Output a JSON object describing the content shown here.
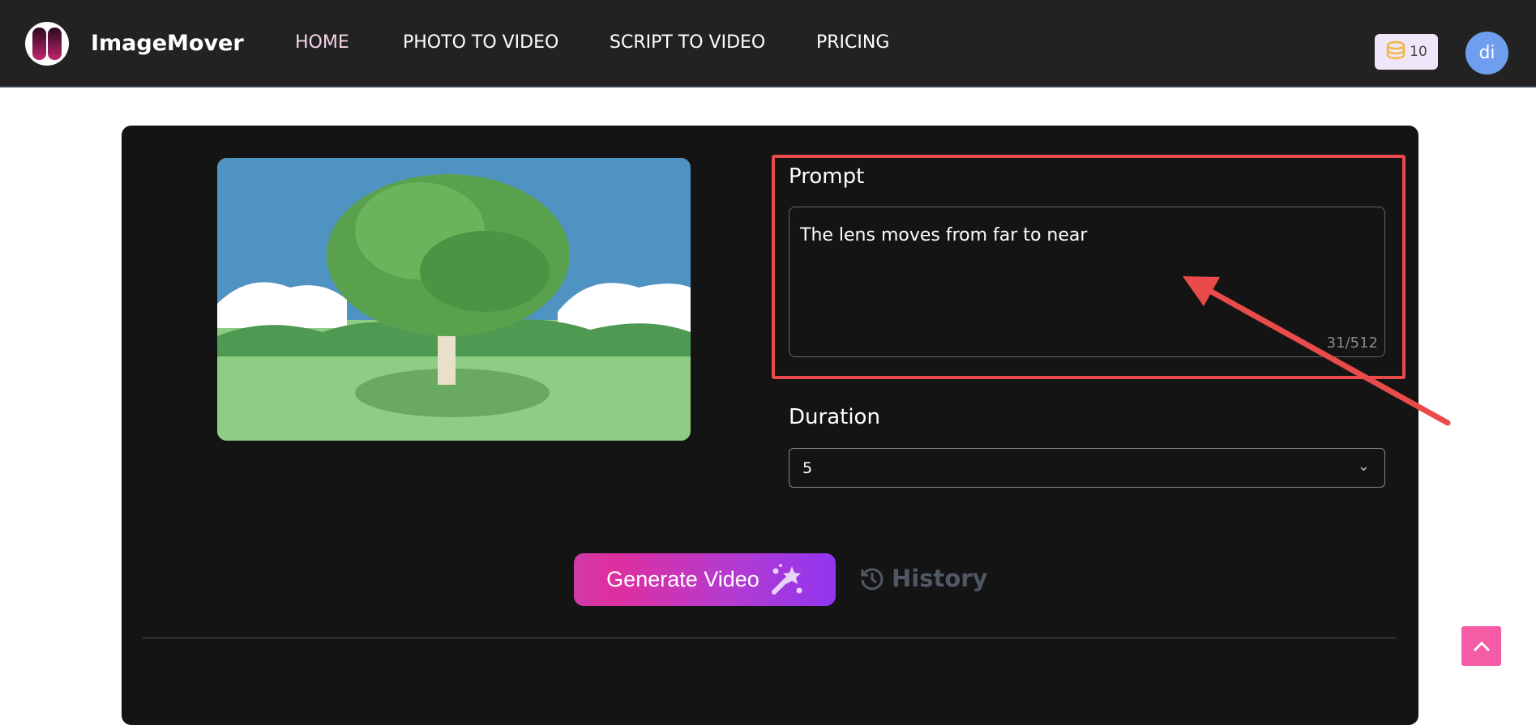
{
  "header": {
    "brand": "ImageMover",
    "nav": [
      "HOME",
      "PHOTO TO VIDEO",
      "SCRIPT TO VIDEO",
      "PRICING"
    ],
    "active_nav": "HOME",
    "credits": "10",
    "avatar": "di"
  },
  "form": {
    "prompt_label": "Prompt",
    "prompt_value": "The lens moves from far to near",
    "char_count": "31/512",
    "duration_label": "Duration",
    "duration_value": "5",
    "generate_label": "Generate Video",
    "history_label": "History"
  },
  "colors": {
    "annotation": "#e94b4b",
    "accent": "#f45ca6",
    "active_nav": "#f7d4e8"
  }
}
